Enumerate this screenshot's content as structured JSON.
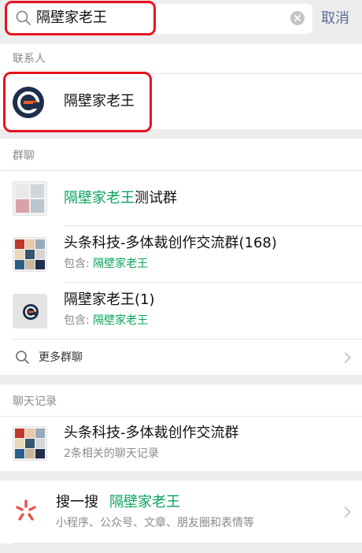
{
  "search": {
    "query": "隔壁家老王",
    "cancel_label": "取消"
  },
  "contacts": {
    "section_title": "联系人",
    "items": [
      {
        "name": "隔壁家老王"
      }
    ]
  },
  "groups": {
    "section_title": "群聊",
    "items": [
      {
        "name_highlight": "隔壁家老王",
        "name_rest": "测试群"
      },
      {
        "name": "头条科技-多体裁创作交流群(168)",
        "sub_prefix": "包含: ",
        "sub_highlight": "隔壁家老王"
      },
      {
        "name": "隔壁家老王(1)",
        "sub_prefix": "包含: ",
        "sub_highlight": "隔壁家老王"
      }
    ],
    "more_label": "更多群聊"
  },
  "chat_records": {
    "section_title": "聊天记录",
    "items": [
      {
        "name": "头条科技-多体裁创作交流群",
        "sub": "2条相关的聊天记录"
      }
    ]
  },
  "souyisou": {
    "title": "搜一搜",
    "query": "隔壁家老王",
    "sub": "小程序、公众号、文章、朋友圈和表情等"
  },
  "colors": {
    "highlight_green": "#07a35a",
    "annotation_red": "#e6141f",
    "cancel_blue": "#5b6b92",
    "logo_navy": "#1f2f4a",
    "logo_orange": "#ee5a24"
  }
}
